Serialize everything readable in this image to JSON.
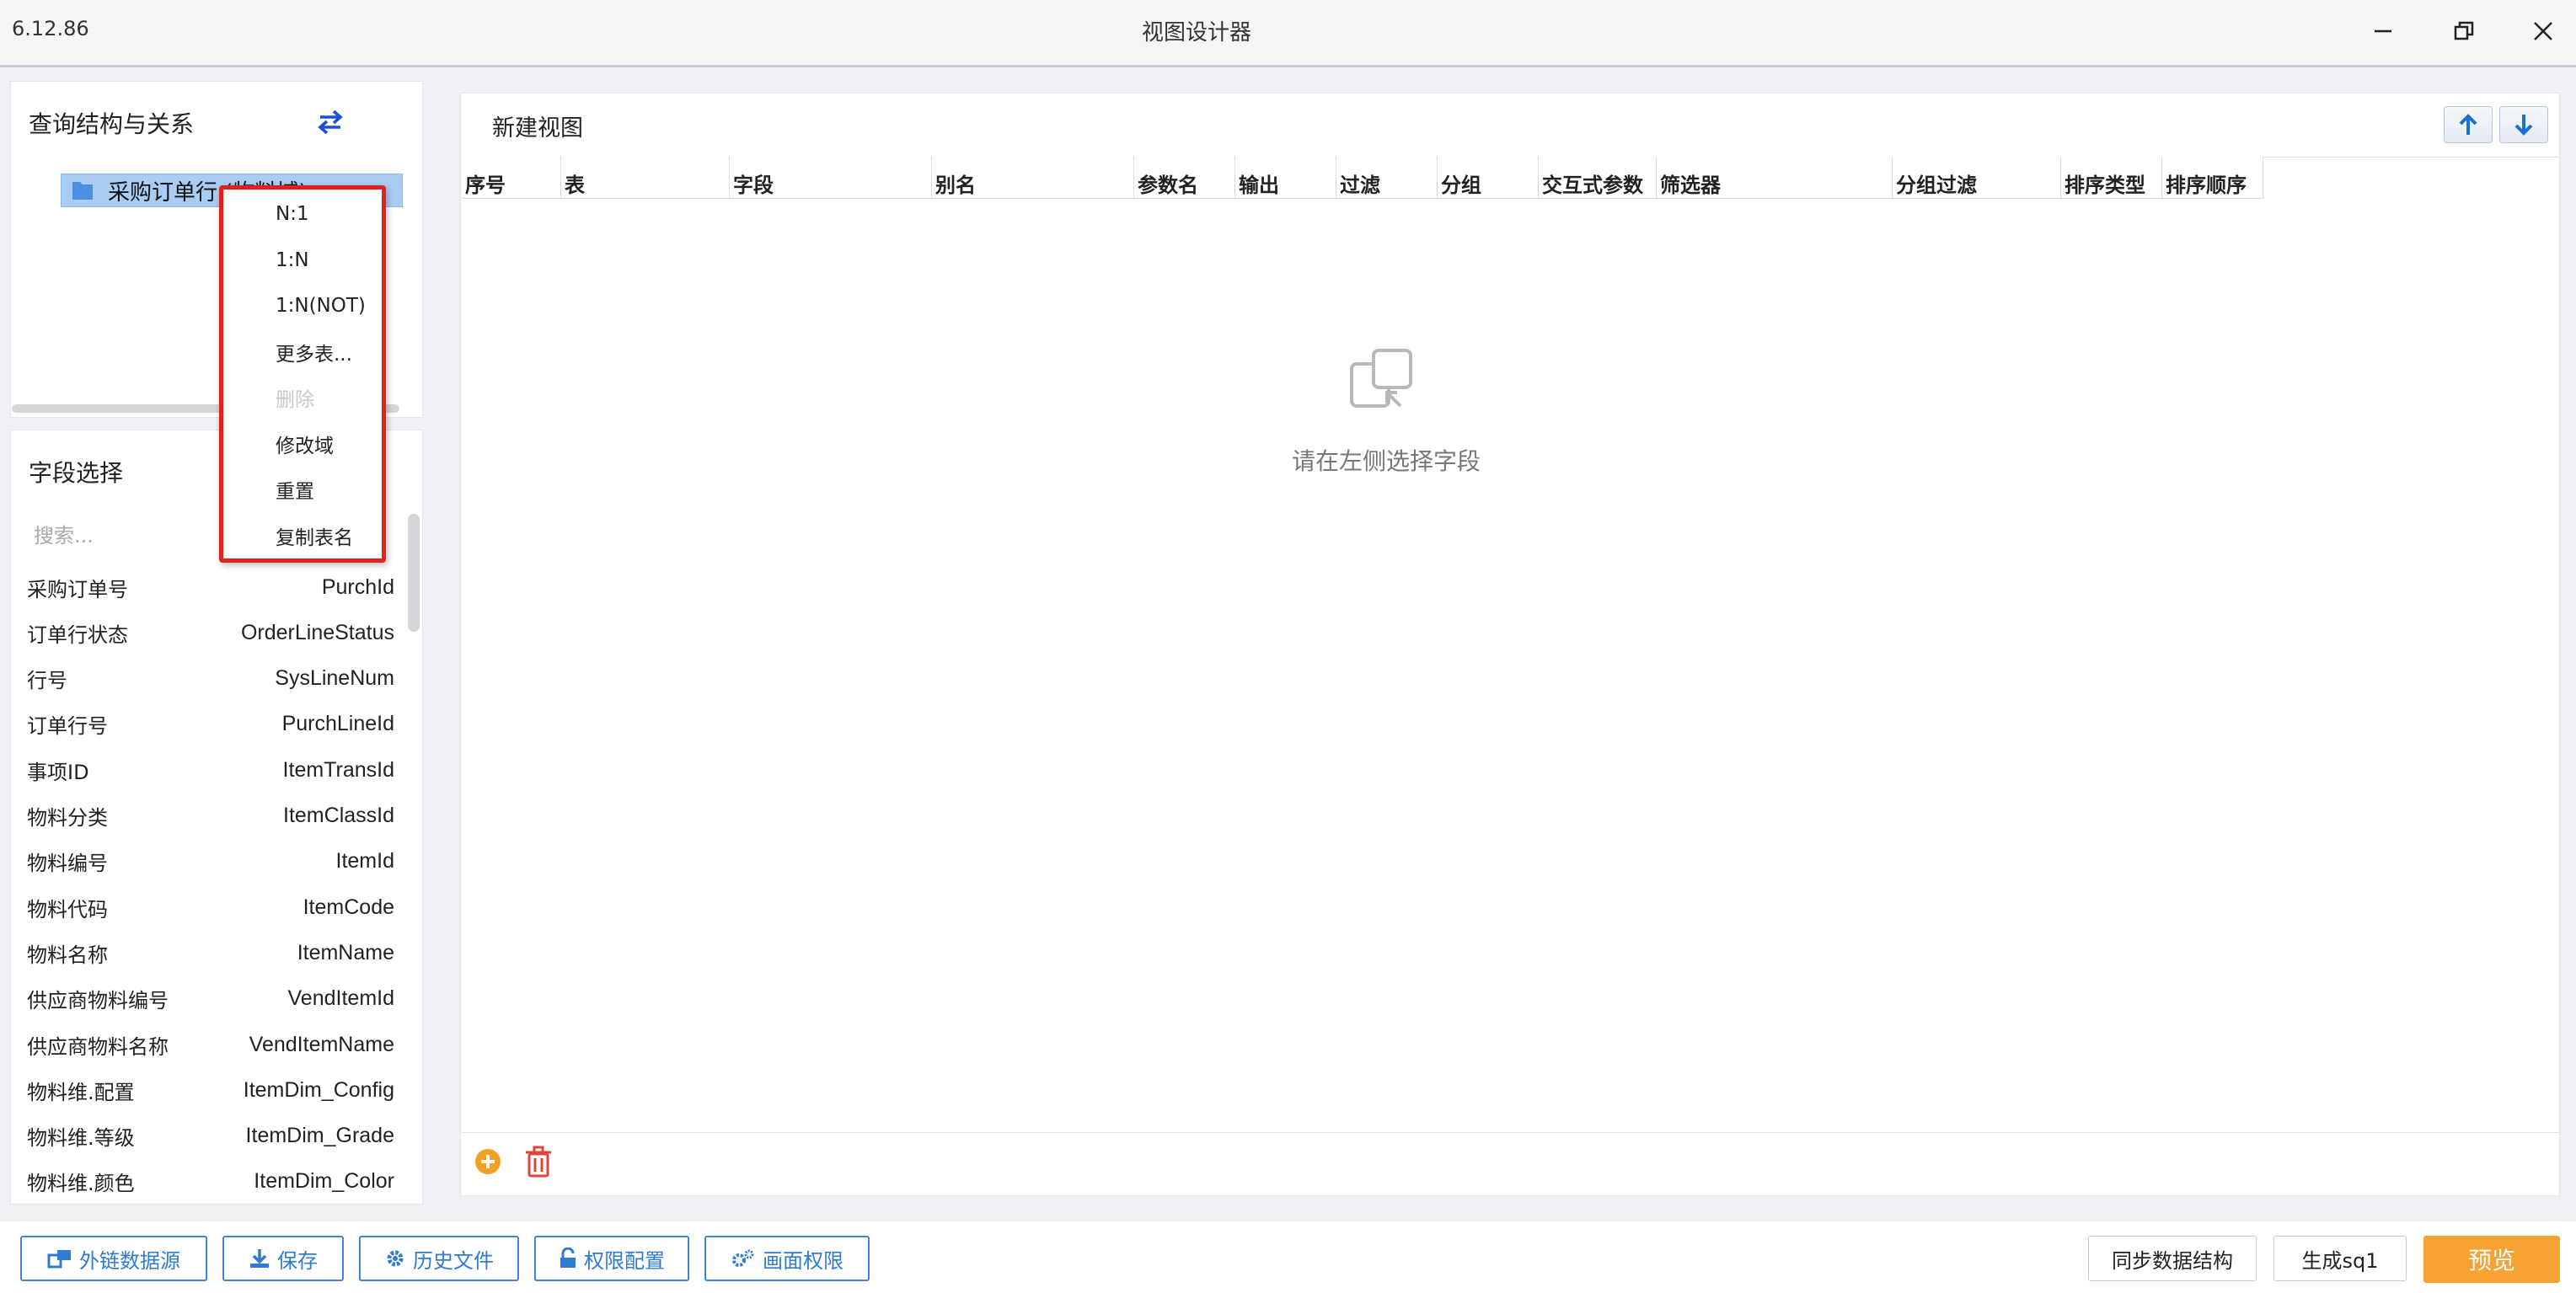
{
  "window": {
    "version": "6.12.86",
    "title": "视图设计器",
    "icons": [
      "minimize-icon",
      "restore-icon",
      "close-icon"
    ]
  },
  "relations": {
    "heading": "查询结构与关系",
    "swap_icon": "swap-arrows-icon",
    "tree_node_label": "采购订单行 (物料域)"
  },
  "context_menu": {
    "items": [
      {
        "label": "N:1",
        "enabled": true
      },
      {
        "label": "1:N",
        "enabled": true
      },
      {
        "label": "1:N(NOT)",
        "enabled": true
      },
      {
        "label": "更多表...",
        "enabled": true
      },
      {
        "label": "删除",
        "enabled": false
      },
      {
        "label": "修改域",
        "enabled": true
      },
      {
        "label": "重置",
        "enabled": true
      },
      {
        "label": "复制表名",
        "enabled": true
      }
    ]
  },
  "fields": {
    "heading": "字段选择",
    "search_placeholder": "搜索...",
    "rows": [
      {
        "label": "采购订单号",
        "name": "PurchId"
      },
      {
        "label": "订单行状态",
        "name": "OrderLineStatus"
      },
      {
        "label": "行号",
        "name": "SysLineNum"
      },
      {
        "label": "订单行号",
        "name": "PurchLineId"
      },
      {
        "label": "事项ID",
        "name": "ItemTransId"
      },
      {
        "label": "物料分类",
        "name": "ItemClassId"
      },
      {
        "label": "物料编号",
        "name": "ItemId"
      },
      {
        "label": "物料代码",
        "name": "ItemCode"
      },
      {
        "label": "物料名称",
        "name": "ItemName"
      },
      {
        "label": "供应商物料编号",
        "name": "VendItemId"
      },
      {
        "label": "供应商物料名称",
        "name": "VendItemName"
      },
      {
        "label": "物料维.配置",
        "name": "ItemDim_Config"
      },
      {
        "label": "物料维.等级",
        "name": "ItemDim_Grade"
      },
      {
        "label": "物料维.颜色",
        "name": "ItemDim_Color"
      }
    ]
  },
  "view": {
    "title": "新建视图",
    "columns": [
      "序号",
      "表",
      "字段",
      "别名",
      "参数名",
      "输出",
      "过滤",
      "分组",
      "交互式参数",
      "筛选器",
      "分组过滤",
      "排序类型",
      "排序顺序"
    ],
    "empty_text": "请在左侧选择字段",
    "empty_icon": "select-field-icon",
    "toolbar_icons": [
      "move-up-icon",
      "move-down-icon",
      "add-icon",
      "delete-icon"
    ]
  },
  "bottom": {
    "buttons": [
      {
        "label": "外链数据源",
        "icon": "external-datasource-icon"
      },
      {
        "label": "保存",
        "icon": "save-icon"
      },
      {
        "label": "历史文件",
        "icon": "gear-icon"
      },
      {
        "label": "权限配置",
        "icon": "lock-icon"
      },
      {
        "label": "画面权限",
        "icon": "gears-icon"
      }
    ],
    "sync_label": "同步数据结构",
    "sql_label": "生成sq1",
    "preview_label": "预览"
  },
  "colors": {
    "accent_blue": "#2f7bd0",
    "preview_orange": "#f7a234",
    "highlight_red": "#e0211e",
    "selection_blue": "#a9ccf2"
  }
}
